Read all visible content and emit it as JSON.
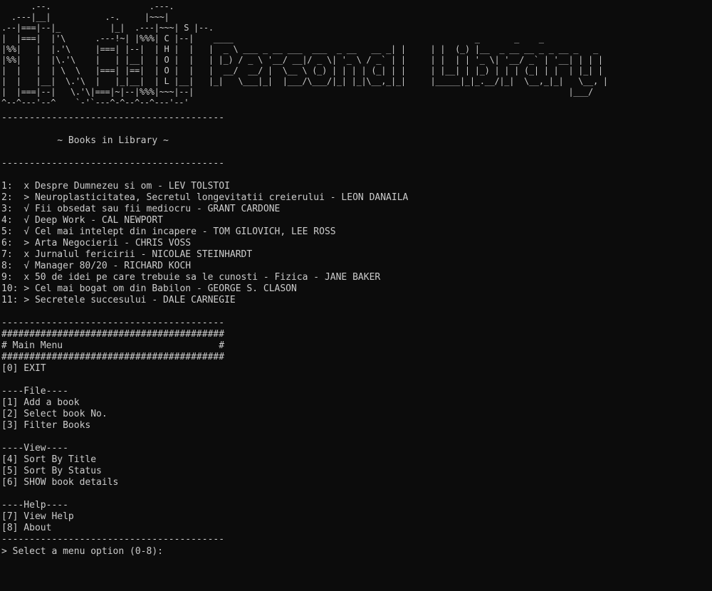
{
  "banner": {
    "art": "      .--.                    .---.\n  .---|__|           .-.     |~~~|\n.--|===|--|_          |_|  .---|~~~| S |--.\n|  |===|  |'\\      .---!~| |%%%| C |--|    ____                                                 _       _    _\n|%%|   |  |.'\\     |===| |--|  | H |  |   |  _ \\ ___ _ __ ___  ___  _ __   __ _| |     | |  (_) |__  _ __ __ _ _ __ _   _\n|%%|   |  |\\.'\\    |   | |__|  | O |  |   | |_) / _ \\ '__/ __|/ _ \\| '_ \\ / _` | |     | |  | | '_ \\| '__/ _` | '__| | | |\n|  |   |  | \\  \\   |===| |==|  | O |  |   |  __/  __/ |  \\__ \\ (_) | | | | (_| | |     | |__| | |_) | | | (_| | |  | |_| |\n|  |   |__|  \\.'\\  |   |_|__|  | L |__|   |_|   \\___|_|  |___/\\___/|_| |_|\\__,_|_|     |_____|_|_.__/|_|  \\__,_|_|   \\__, |\n|  |===|--|   \\.'\\|===|~|--|%%%|~~~|--|                                                                            |___/\n^--^---'--^    `-'`---^-^--^--^---'--'"
  },
  "divider": "----------------------------------------",
  "hash_line": "########################################",
  "section_title": "~ Books in Library ~",
  "books": [
    {
      "num": "1:",
      "status": "x",
      "text": "Despre Dumnezeu si om - LEV TOLSTOI"
    },
    {
      "num": "2:",
      "status": ">",
      "text": "Neuroplasticitatea, Secretul longevitatii creierului - LEON DANAILA"
    },
    {
      "num": "3:",
      "status": "√",
      "text": "Fii obsedat sau fii mediocru - GRANT CARDONE"
    },
    {
      "num": "4:",
      "status": "√",
      "text": "Deep Work - CAL NEWPORT"
    },
    {
      "num": "5:",
      "status": "√",
      "text": "Cel mai intelept din incapere - TOM GILOVICH, LEE ROSS"
    },
    {
      "num": "6:",
      "status": ">",
      "text": "Arta Negocierii - CHRIS VOSS"
    },
    {
      "num": "7:",
      "status": "x",
      "text": "Jurnalul fericirii - NICOLAE STEINHARDT"
    },
    {
      "num": "8:",
      "status": "√",
      "text": "Manager 80/20 - RICHARD KOCH"
    },
    {
      "num": "9:",
      "status": "x",
      "text": "50 de idei pe care trebuie sa le cunosti - Fizica - JANE BAKER"
    },
    {
      "num": "10:",
      "status": ">",
      "text": "Cel mai bogat om din Babilon - GEORGE S. CLASON"
    },
    {
      "num": "11:",
      "status": ">",
      "text": "Secretele succesului - DALE CARNEGIE"
    }
  ],
  "menu": {
    "title_line": "# Main Menu                            #",
    "exit": "[0] EXIT",
    "file_header": "----File----",
    "file_items": [
      "[1] Add a book",
      "[2] Select book No.",
      "[3] Filter Books"
    ],
    "view_header": "----View----",
    "view_items": [
      "[4] Sort By Title",
      "[5] Sort By Status",
      "[6] SHOW book details"
    ],
    "help_header": "----Help----",
    "help_items": [
      "[7] View Help",
      "[8] About"
    ],
    "prompt": "> Select a menu option (0-8):"
  }
}
